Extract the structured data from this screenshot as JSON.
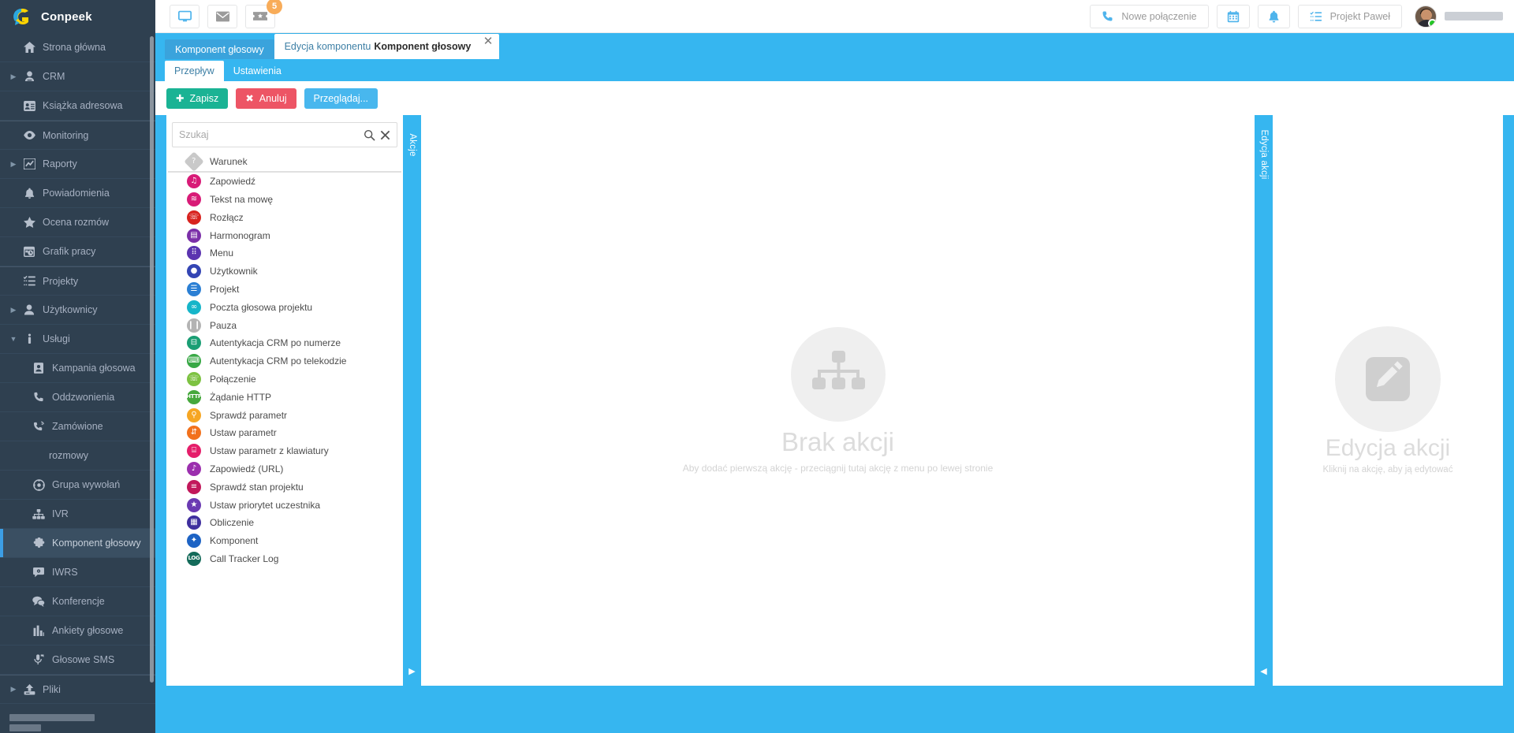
{
  "brand": {
    "name": "Conpeek"
  },
  "sidebar": {
    "items": [
      {
        "label": "Strona główna",
        "icon": "home-icon",
        "caret": false,
        "active": false,
        "sub": false
      },
      {
        "label": "CRM",
        "icon": "user-icon",
        "caret": true,
        "active": false,
        "sub": false
      },
      {
        "label": "Książka adresowa",
        "icon": "address-book-icon",
        "caret": false,
        "active": false,
        "sub": false
      },
      {
        "label": "Monitoring",
        "icon": "eye-icon",
        "caret": false,
        "active": false,
        "sub": false
      },
      {
        "label": "Raporty",
        "icon": "chart-line-icon",
        "caret": true,
        "active": false,
        "sub": false
      },
      {
        "label": "Powiadomienia",
        "icon": "bell-icon",
        "caret": false,
        "active": false,
        "sub": false
      },
      {
        "label": "Ocena rozmów",
        "icon": "star-icon",
        "caret": false,
        "active": false,
        "sub": false
      },
      {
        "label": "Grafik pracy",
        "icon": "calendar-clock-icon",
        "caret": false,
        "active": false,
        "sub": false
      },
      {
        "label": "Projekty",
        "icon": "tasks-icon",
        "caret": false,
        "active": false,
        "sub": false
      },
      {
        "label": "Użytkownicy",
        "icon": "users-icon",
        "caret": true,
        "active": false,
        "sub": false
      },
      {
        "label": "Usługi",
        "icon": "info-icon",
        "caret": true,
        "caretDown": true,
        "active": false,
        "sub": false
      },
      {
        "label": "Kampania głosowa",
        "icon": "contact-card-icon",
        "caret": false,
        "active": false,
        "sub": true
      },
      {
        "label": "Oddzwonienia",
        "icon": "phone-icon",
        "caret": false,
        "active": false,
        "sub": true
      },
      {
        "label": "Zamówione",
        "icon": "phone-volume-icon",
        "caret": false,
        "active": false,
        "sub": true
      },
      {
        "label": "rozmowy",
        "icon": "",
        "caret": false,
        "active": false,
        "sub": true,
        "plain": true
      },
      {
        "label": "Grupa wywołań",
        "icon": "crosshair-icon",
        "caret": false,
        "active": false,
        "sub": true
      },
      {
        "label": "IVR",
        "icon": "sitemap-icon",
        "caret": false,
        "active": false,
        "sub": true
      },
      {
        "label": "Komponent głosowy",
        "icon": "puzzle-icon",
        "caret": false,
        "active": true,
        "sub": true
      },
      {
        "label": "IWRS",
        "icon": "comment-gear-icon",
        "caret": false,
        "active": false,
        "sub": true
      },
      {
        "label": "Konferencje",
        "icon": "comments-icon",
        "caret": false,
        "active": false,
        "sub": true
      },
      {
        "label": "Ankiety głosowe",
        "icon": "bar-chart-icon",
        "caret": false,
        "active": false,
        "sub": true
      },
      {
        "label": "Głosowe SMS",
        "icon": "microphone-icon",
        "caret": false,
        "active": false,
        "sub": true
      },
      {
        "label": "Pliki",
        "icon": "upload-icon",
        "caret": true,
        "active": false,
        "sub": false
      }
    ]
  },
  "topbar": {
    "icon_buttons": [
      {
        "name": "desktop-icon",
        "badge": null
      },
      {
        "name": "envelope-icon",
        "badge": null
      },
      {
        "name": "ticket-icon",
        "badge": "5"
      }
    ],
    "new_call_label": "Nowe połączenie",
    "calendar_label": "",
    "bell_label": "",
    "project_label": "Projekt Paweł"
  },
  "tabs": {
    "primary": {
      "label": "Komponent głosowy"
    },
    "secondary": {
      "prefix": "Edycja komponentu",
      "name": "Komponent głosowy",
      "close": "✕"
    },
    "sub": [
      {
        "label": "Przepływ",
        "active": true
      },
      {
        "label": "Ustawienia",
        "active": false
      }
    ]
  },
  "toolbar": {
    "save_label": "Zapisz",
    "cancel_label": "Anuluj",
    "browse_label": "Przeglądaj..."
  },
  "search": {
    "placeholder": "Szukaj",
    "value": "",
    "search_icon": "search-icon",
    "clear_icon": "close-icon"
  },
  "action_list": [
    {
      "label": "Warunek",
      "icon": "question-diamond-icon",
      "color": "#c9c9c9",
      "shape": "diamond",
      "glyph": "?"
    },
    {
      "label": "Zapowiedź",
      "icon": "music-notes-icon",
      "color": "#d81b77",
      "shape": "circle",
      "glyph": "♫"
    },
    {
      "label": "Tekst na mowę",
      "icon": "text-to-speech-icon",
      "color": "#d81b77",
      "shape": "circle",
      "glyph": "≋"
    },
    {
      "label": "Rozłącz",
      "icon": "hangup-phone-icon",
      "color": "#d8231f",
      "shape": "circle",
      "glyph": "☏"
    },
    {
      "label": "Harmonogram",
      "icon": "schedule-icon",
      "color": "#7b2fa8",
      "shape": "circle",
      "glyph": "▤"
    },
    {
      "label": "Menu",
      "icon": "keypad-icon",
      "color": "#5b34b0",
      "shape": "circle",
      "glyph": "⠿"
    },
    {
      "label": "Użytkownik",
      "icon": "user-circle-icon",
      "color": "#3445b4",
      "shape": "circle",
      "glyph": "●"
    },
    {
      "label": "Projekt",
      "icon": "project-list-icon",
      "color": "#2b7fd4",
      "shape": "circle",
      "glyph": "☰"
    },
    {
      "label": "Poczta głosowa projektu",
      "icon": "voicemail-icon",
      "color": "#16b5c9",
      "shape": "circle",
      "glyph": "∞"
    },
    {
      "label": "Pauza",
      "icon": "pause-icon",
      "color": "#b3b3b3",
      "shape": "circle",
      "glyph": "❙❙"
    },
    {
      "label": "Autentykacja CRM po numerze",
      "icon": "crm-auth-number-icon",
      "color": "#1a9e74",
      "shape": "circle",
      "glyph": "⊟"
    },
    {
      "label": "Autentykacja CRM po telekodzie",
      "icon": "crm-auth-code-icon",
      "color": "#38a845",
      "shape": "circle",
      "glyph": "⌨"
    },
    {
      "label": "Połączenie",
      "icon": "call-icon",
      "color": "#7dc242",
      "shape": "circle",
      "glyph": "☏"
    },
    {
      "label": "Żądanie HTTP",
      "icon": "http-request-icon",
      "color": "#46a83c",
      "shape": "circle",
      "glyph": "HTTP"
    },
    {
      "label": "Sprawdź parametr",
      "icon": "check-parameter-icon",
      "color": "#f6a623",
      "shape": "circle",
      "glyph": "⚲"
    },
    {
      "label": "Ustaw parametr",
      "icon": "set-parameter-icon",
      "color": "#f2711c",
      "shape": "circle",
      "glyph": "⇵"
    },
    {
      "label": "Ustaw parametr z klawiatury",
      "icon": "set-parameter-dtmf-icon",
      "color": "#e51e6a",
      "shape": "circle",
      "glyph": "⌸"
    },
    {
      "label": "Zapowiedź (URL)",
      "icon": "announcement-url-icon",
      "color": "#9b2fae",
      "shape": "circle",
      "glyph": "♪"
    },
    {
      "label": "Sprawdź stan projektu",
      "icon": "project-state-icon",
      "color": "#c2185b",
      "shape": "circle",
      "glyph": "≡"
    },
    {
      "label": "Ustaw priorytet uczestnika",
      "icon": "participant-priority-icon",
      "color": "#6a3ab2",
      "shape": "circle",
      "glyph": "★"
    },
    {
      "label": "Obliczenie",
      "icon": "calculator-icon",
      "color": "#3f2f9e",
      "shape": "circle",
      "glyph": "▦"
    },
    {
      "label": "Komponent",
      "icon": "component-puzzle-icon",
      "color": "#1d63c4",
      "shape": "circle",
      "glyph": "✦"
    },
    {
      "label": "Call Tracker Log",
      "icon": "call-tracker-log-icon",
      "color": "#146b5a",
      "shape": "circle",
      "glyph": "LOG"
    }
  ],
  "side_tabs": {
    "left": {
      "label": "Akcje",
      "arrow": "▶"
    },
    "right": {
      "label": "Edycja akcji",
      "arrow": "◀"
    }
  },
  "canvas": {
    "title": "Brak akcji",
    "subtitle": "Aby dodać pierwszą akcję - przeciągnij tutaj akcję z menu po lewej stronie",
    "icon": "sitemap-placeholder-icon"
  },
  "editor_panel": {
    "title": "Edycja akcji",
    "subtitle": "Kliknij na akcję, aby ją edytować",
    "icon": "pencil-placeholder-icon"
  },
  "colors": {
    "sidebar_bg": "#2f4050",
    "accent_blue": "#36b6f0",
    "green": "#1ab394",
    "red": "#ed5565",
    "badge_orange": "#f8ac59"
  }
}
